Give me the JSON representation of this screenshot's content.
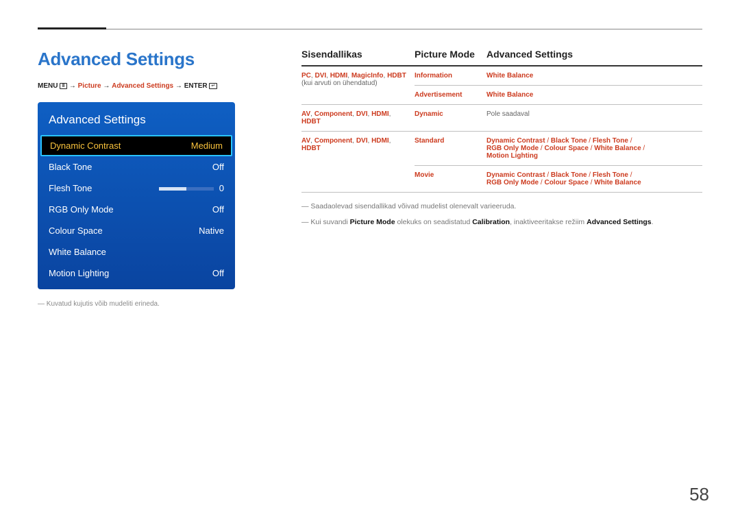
{
  "page_title": "Advanced Settings",
  "breadcrumb": {
    "menu": "MENU",
    "sep": "→",
    "path_red": [
      "Picture",
      "Advanced Settings"
    ],
    "enter": "ENTER"
  },
  "osd": {
    "title": "Advanced Settings",
    "rows": [
      {
        "label": "Dynamic Contrast",
        "value": "Medium",
        "highlight": true
      },
      {
        "label": "Black Tone",
        "value": "Off"
      },
      {
        "label": "Flesh Tone",
        "value": "0",
        "slider": true
      },
      {
        "label": "RGB Only Mode",
        "value": "Off"
      },
      {
        "label": "Colour Space",
        "value": "Native"
      },
      {
        "label": "White Balance",
        "value": ""
      },
      {
        "label": "Motion Lighting",
        "value": "Off"
      }
    ]
  },
  "panel_note": "Kuvatud kujutis võib mudeliti erineda.",
  "table": {
    "headers": [
      "Sisendallikas",
      "Picture Mode",
      "Advanced Settings"
    ],
    "rows": [
      {
        "src_parts": [
          "PC",
          ", ",
          "DVI",
          ", ",
          "HDMI",
          ", ",
          "MagicInfo",
          ", ",
          "HDBT"
        ],
        "src_tail": " (kui arvuti on ühendatud)",
        "rowspan": 2,
        "pm": "Information",
        "adv": [
          [
            "White Balance"
          ]
        ]
      },
      {
        "pm": "Advertisement",
        "adv": [
          [
            "White Balance"
          ]
        ]
      },
      {
        "src_parts": [
          "AV",
          ", ",
          "Component",
          ", ",
          "DVI",
          ", ",
          "HDMI",
          ", ",
          "HDBT"
        ],
        "src_tail": "",
        "pm": "Dynamic",
        "adv_plain": "Pole saadaval"
      },
      {
        "src_parts": [
          "AV",
          ", ",
          "Component",
          ", ",
          "DVI",
          ", ",
          "HDMI",
          ", ",
          "HDBT"
        ],
        "src_tail": "",
        "rowspan": 2,
        "pm": "Standard",
        "adv": [
          [
            "Dynamic Contrast",
            "Black Tone",
            "Flesh Tone"
          ],
          [
            "RGB Only Mode",
            "Colour Space",
            "White Balance"
          ],
          [
            "Motion Lighting"
          ]
        ]
      },
      {
        "pm": "Movie",
        "adv": [
          [
            "Dynamic Contrast",
            "Black Tone",
            "Flesh Tone"
          ],
          [
            "RGB Only Mode",
            "Colour Space",
            "White Balance"
          ]
        ]
      }
    ]
  },
  "note1": "Saadaolevad sisendallikad võivad mudelist olenevalt varieeruda.",
  "note2_a": "Kui suvandi ",
  "note2_b": "Picture Mode",
  "note2_c": " olekuks on seadistatud ",
  "note2_d": "Calibration",
  "note2_e": ", inaktiveeritakse režiim ",
  "note2_f": "Advanced Settings",
  "note2_g": ".",
  "page_number": "58"
}
